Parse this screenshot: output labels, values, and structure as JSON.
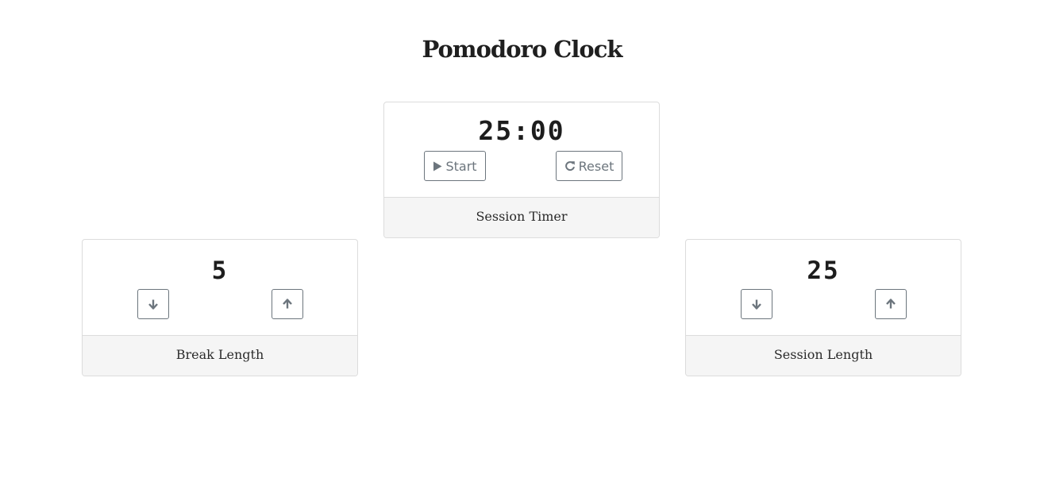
{
  "header": {
    "title": "Pomodoro Clock"
  },
  "session_timer": {
    "time": "25:00",
    "start_label": "Start",
    "reset_label": "Reset",
    "footer_label": "Session Timer"
  },
  "break_length": {
    "value": "5",
    "footer_label": "Break Length"
  },
  "session_length": {
    "value": "25",
    "footer_label": "Session Length"
  },
  "icons": {
    "start": "play-icon",
    "reset": "redo-icon",
    "decrement": "arrow-down-icon",
    "increment": "arrow-up-icon"
  },
  "colors": {
    "button_outline": "#6c757d",
    "footer_bg": "#f5f5f5",
    "card_border": "#dcdcdc"
  }
}
